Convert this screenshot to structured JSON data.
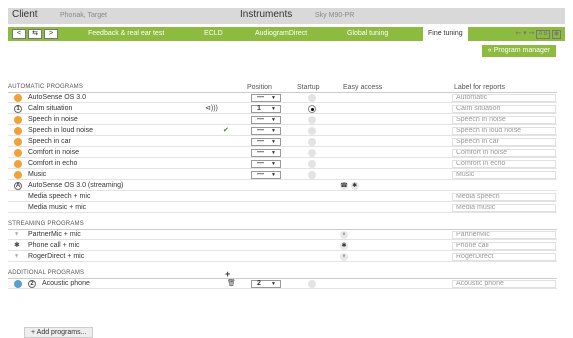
{
  "header": {
    "client_label": "Client",
    "client_name": "Phonak, Target",
    "instruments_label": "Instruments",
    "instruments_model": "Sky M90-PR"
  },
  "nav": {
    "back_glyph": "<",
    "swap_glyph": "⇆",
    "forward_glyph": ">",
    "tabs": [
      {
        "label": "Feedback & real ear test"
      },
      {
        "label": "ECLD"
      },
      {
        "label": "AudiogramDirect"
      },
      {
        "label": "Global tuning"
      },
      {
        "label": "Fine tuning"
      }
    ],
    "tab_icons": "⇜ ▾ ⇝",
    "ab_label": "A B"
  },
  "program_manager_label": "« Program manager",
  "columns": {
    "position": "Position",
    "startup": "Startup",
    "easy_access": "Easy access",
    "label_for_reports": "Label for reports"
  },
  "sections": {
    "automatic": "AUTOMATIC PROGRAMS",
    "streaming": "STREAMING PROGRAMS",
    "additional": "ADDITIONAL PROGRAMS"
  },
  "automatic_programs": [
    {
      "name": "AutoSense OS 3.0",
      "position": "—",
      "report": "Automatic",
      "startup": false
    },
    {
      "name": "Calm situation",
      "position": "1",
      "report": "Calm situation",
      "startup": true,
      "badge": "1",
      "indicator": "⊲)))"
    },
    {
      "name": "Speech in noise",
      "position": "—",
      "report": "Speech in noise",
      "startup": false
    },
    {
      "name": "Speech in loud noise",
      "position": "—",
      "report": "Speech in loud noise",
      "startup": false,
      "indicator": "✔"
    },
    {
      "name": "Speech in car",
      "position": "—",
      "report": "Speech in car",
      "startup": false
    },
    {
      "name": "Comfort in noise",
      "position": "—",
      "report": "Comfort in noise",
      "startup": false
    },
    {
      "name": "Comfort in echo",
      "position": "—",
      "report": "Comfort in echo",
      "startup": false
    },
    {
      "name": "Music",
      "position": "—",
      "report": "Music",
      "startup": false
    }
  ],
  "autosense_streaming": {
    "badge": "A",
    "name": "AutoSense OS 3.0 (streaming)",
    "access_icons": [
      "☎",
      "✱"
    ],
    "subitems": [
      {
        "name": "Media speech + mic",
        "report": "Media speech"
      },
      {
        "name": "Media music + mic",
        "report": "Media music"
      }
    ]
  },
  "streaming_programs": [
    {
      "name": "PartnerMic + mic",
      "icon": "♆",
      "access": "♆",
      "report": "PartnerMic"
    },
    {
      "name": "Phone call + mic",
      "icon": "✱",
      "access": "✱",
      "report": "Phone call"
    },
    {
      "name": "RogerDirect + mic",
      "icon": "♆",
      "access": "♆",
      "report": "RogerDirect"
    }
  ],
  "additional_programs": [
    {
      "name": "Acoustic phone",
      "position": "2",
      "badge": "2",
      "report": "Acoustic phone",
      "indicator": "🗑"
    }
  ],
  "add_programs_label": "+ Add programs...",
  "add_glyph": "+",
  "dropdown_arrow": "▼",
  "colors": {
    "accent_green": "#8dbb3f",
    "header_gray": "#d9d9d9",
    "auto_orange": "#f0a23a",
    "blue": "#5a9ed6"
  }
}
